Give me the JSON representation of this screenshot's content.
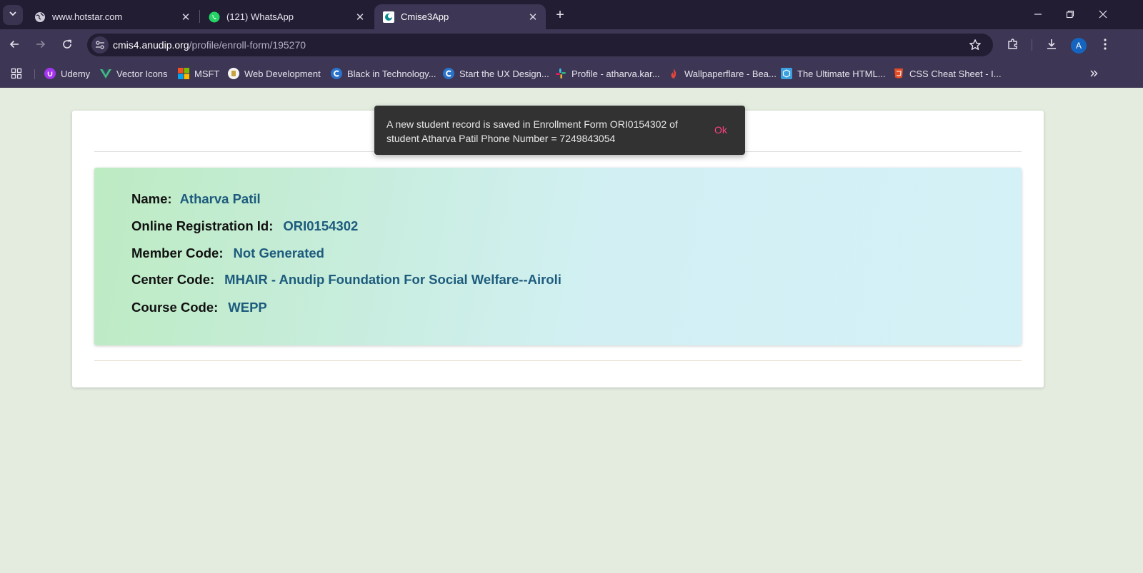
{
  "browser": {
    "tabs": [
      {
        "title": "www.hotstar.com",
        "icon": "globe-icon"
      },
      {
        "title": "(121) WhatsApp",
        "icon": "whatsapp-icon"
      },
      {
        "title": "Cmise3App",
        "icon": "cmise-icon"
      }
    ],
    "url": {
      "host": "cmis4.anudip.org",
      "path": "/profile/enroll-form/195270"
    },
    "avatar_letter": "A",
    "bookmarks": [
      {
        "label": "Udemy",
        "icon": "udemy-icon"
      },
      {
        "label": "Vector Icons",
        "icon": "vue-icon"
      },
      {
        "label": "MSFT",
        "icon": "microsoft-icon"
      },
      {
        "label": "Web Development",
        "icon": "web-dev-icon"
      },
      {
        "label": "Black in Technology...",
        "icon": "coursera-icon"
      },
      {
        "label": "Start the UX Design...",
        "icon": "coursera-icon"
      },
      {
        "label": "Profile - atharva.kar...",
        "icon": "slack-icon"
      },
      {
        "label": "Wallpaperflare - Bea...",
        "icon": "flame-icon"
      },
      {
        "label": "The Ultimate HTML...",
        "icon": "html-guide-icon"
      },
      {
        "label": "CSS Cheat Sheet - I...",
        "icon": "css-icon"
      }
    ]
  },
  "snackbar": {
    "message": "A new student record is saved in Enrollment Form ORI0154302 of student Atharva Patil Phone Number = 7249843054",
    "action": "Ok"
  },
  "student": {
    "name_label": "Name:",
    "name": "Atharva Patil",
    "reg_label": "Online Registration Id:",
    "reg_id": "ORI0154302",
    "member_label": "Member Code:",
    "member_code": "Not Generated",
    "center_label": "Center Code:",
    "center_code": "MHAIR - Anudip Foundation For Social Welfare--Airoli",
    "course_label": "Course Code:",
    "course_code": "WEPP"
  },
  "colors": {
    "value_text": "#1d5b7d",
    "snackbar_bg": "#323232",
    "snackbar_action": "#ff4081",
    "page_bg": "#e4ece0"
  }
}
